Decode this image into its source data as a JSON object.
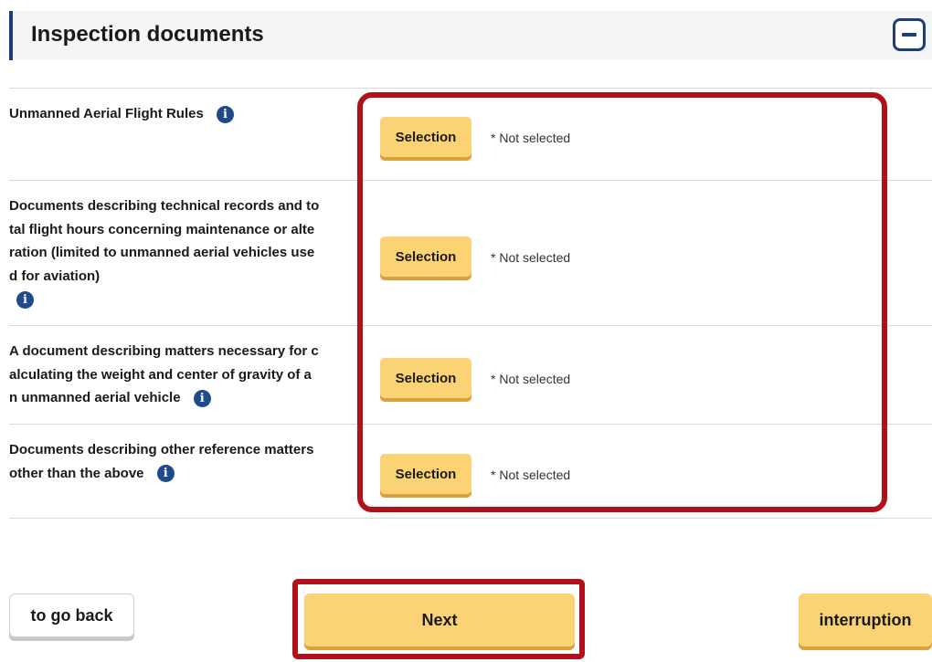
{
  "section": {
    "title": "Inspection documents",
    "collapse_icon": "minus-icon"
  },
  "documents": [
    {
      "lines": [
        "Unmanned Aerial Flight Rules"
      ],
      "button_label": "Selection",
      "status": "* Not selected"
    },
    {
      "lines": [
        "Documents describing technical records and to",
        "tal flight hours concerning maintenance or alte",
        "ration (limited to unmanned aerial vehicles use",
        "d for aviation)"
      ],
      "button_label": "Selection",
      "status": "* Not selected"
    },
    {
      "lines": [
        "A document describing matters necessary for c",
        "alculating the weight and center of gravity of a",
        "n unmanned aerial vehicle"
      ],
      "button_label": "Selection",
      "status": "* Not selected"
    },
    {
      "lines": [
        "Documents describing other reference matters",
        "other than the above"
      ],
      "button_label": "Selection",
      "status": "* Not selected"
    }
  ],
  "info_icon_glyph": "i",
  "footer": {
    "back_label": "to go back",
    "next_label": "Next",
    "interrupt_label": "interruption"
  },
  "colors": {
    "accent_yellow": "#fcd374",
    "navy": "#1f3f74",
    "highlight_red": "#b0111b"
  }
}
